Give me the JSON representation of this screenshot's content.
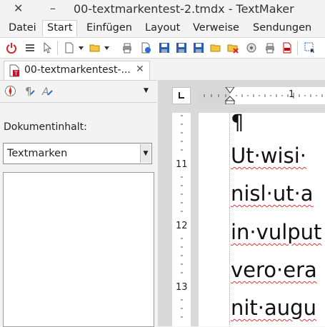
{
  "window": {
    "title": "00-textmarkentest-2.tmdx - TextMaker",
    "minimize_glyph": "–",
    "close_glyph": "✕"
  },
  "menu": [
    "Datei",
    "Start",
    "Einfügen",
    "Layout",
    "Verweise",
    "Sendungen"
  ],
  "menu_active": "Start",
  "toolbar_icons": [
    "power-icon",
    "menu-icon",
    "pointer-icon",
    "new-document-icon",
    "open-folder-icon",
    "print-icon",
    "document-info-icon",
    "save-icon",
    "save-as-icon",
    "save-all-icon",
    "folder-delete-icon",
    "page-setup-icon",
    "print-preview-icon",
    "pdf-export-icon",
    "selection-icon"
  ],
  "document_tab": {
    "label": "00-textmarkentest-...",
    "close": "✕"
  },
  "sidebar": {
    "section_label": "Dokumentinhalt:",
    "dropdown_value": "Textmarken",
    "dropdown_arrow": "▼",
    "panel_menu_arrow": "▼"
  },
  "ruler": {
    "h_label": "1",
    "v_labels": [
      "11",
      "12",
      "13"
    ]
  },
  "document": {
    "pilcrow": "¶",
    "lines": [
      "Ut·wisi·",
      "nisl·ut·a",
      "in·vulput",
      "vero·era",
      "nit·augu"
    ]
  }
}
